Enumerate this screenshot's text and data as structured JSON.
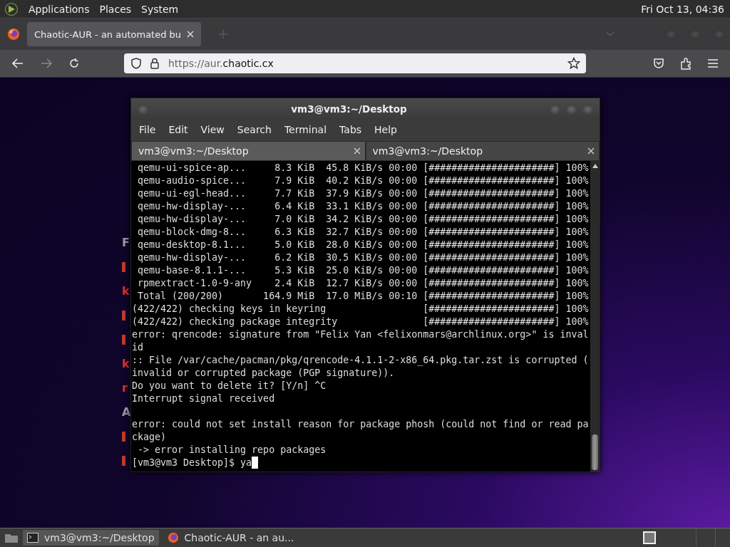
{
  "top_panel": {
    "menus": [
      "Applications",
      "Places",
      "System"
    ],
    "clock": "Fri Oct 13, 04:36"
  },
  "browser": {
    "tab": {
      "title": "Chaotic-AUR - an automated bu",
      "selected": true
    },
    "url": {
      "scheme": "https://aur.",
      "domain": "chaotic.cx"
    },
    "page_fragments": [
      {
        "kind": "text",
        "text": "F",
        "color": "#9a9aa8"
      },
      {
        "kind": "mark",
        "color": "#c0392b"
      },
      {
        "kind": "text",
        "text": "k",
        "color": "#d9342b"
      },
      {
        "kind": "mark",
        "color": "#c0392b"
      },
      {
        "kind": "mark",
        "color": "#c0392b"
      },
      {
        "kind": "text",
        "text": "k",
        "color": "#d9342b"
      },
      {
        "kind": "text",
        "text": "r",
        "color": "#d9342b"
      },
      {
        "kind": "text",
        "text": "A",
        "color": "#9a9aa8"
      },
      {
        "kind": "mark",
        "color": "#c0392b"
      },
      {
        "kind": "mark",
        "color": "#c0392b"
      }
    ]
  },
  "terminal": {
    "title": "vm3@vm3:~/Desktop",
    "menus": [
      "File",
      "Edit",
      "View",
      "Search",
      "Terminal",
      "Tabs",
      "Help"
    ],
    "tabs": [
      {
        "label": "vm3@vm3:~/Desktop",
        "selected": true
      },
      {
        "label": "vm3@vm3:~/Desktop",
        "selected": false
      }
    ],
    "lines": [
      {
        "text": " qemu-ui-spice-ap...     8.3 KiB  45.8 KiB/s 00:00 [######################] 100%"
      },
      {
        "text": " qemu-audio-spice...     7.9 KiB  40.2 KiB/s 00:00 [######################] 100%"
      },
      {
        "text": " qemu-ui-egl-head...     7.7 KiB  37.9 KiB/s 00:00 [######################] 100%"
      },
      {
        "text": " qemu-hw-display-...     6.4 KiB  33.1 KiB/s 00:00 [######################] 100%"
      },
      {
        "text": " qemu-hw-display-...     7.0 KiB  34.2 KiB/s 00:00 [######################] 100%"
      },
      {
        "text": " qemu-block-dmg-8...     6.3 KiB  32.7 KiB/s 00:00 [######################] 100%"
      },
      {
        "text": " qemu-desktop-8.1...     5.0 KiB  28.0 KiB/s 00:00 [######################] 100%"
      },
      {
        "text": " qemu-hw-display-...     6.2 KiB  30.5 KiB/s 00:00 [######################] 100%"
      },
      {
        "text": " qemu-base-8.1.1-...     5.3 KiB  25.0 KiB/s 00:00 [######################] 100%"
      },
      {
        "text": " rpmextract-1.0-9-any    2.4 KiB  12.7 KiB/s 00:00 [######################] 100%"
      },
      {
        "text": " Total (200/200)       164.9 MiB  17.0 MiB/s 00:10 [######################] 100%"
      },
      {
        "text": "(422/422) checking keys in keyring                 [######################] 100%"
      },
      {
        "text": "(422/422) checking package integrity               [######################] 100%"
      },
      {
        "text": "error: qrencode: signature from \"Felix Yan <felixonmars@archlinux.org>\" is inval"
      },
      {
        "text": "id"
      },
      {
        "text": ":: File /var/cache/pacman/pkg/qrencode-4.1.1-2-x86_64.pkg.tar.zst is corrupted ("
      },
      {
        "text": "invalid or corrupted package (PGP signature))."
      },
      {
        "text": "Do you want to delete it? [Y/n] ^C"
      },
      {
        "text": "Interrupt signal received"
      },
      {
        "kind": "blank"
      },
      {
        "text": "error: could not set install reason for package phosh (could not find or read pa"
      },
      {
        "text": "ckage)"
      },
      {
        "text": " -> error installing repo packages"
      }
    ],
    "prompt": "[vm3@vm3 Desktop]$ ya"
  },
  "taskbar": {
    "tasks": [
      {
        "label": "vm3@vm3:~/Desktop",
        "kind": "terminal",
        "selected": true
      },
      {
        "label": "Chaotic-AUR - an au...",
        "kind": "browser",
        "selected": false
      }
    ]
  }
}
